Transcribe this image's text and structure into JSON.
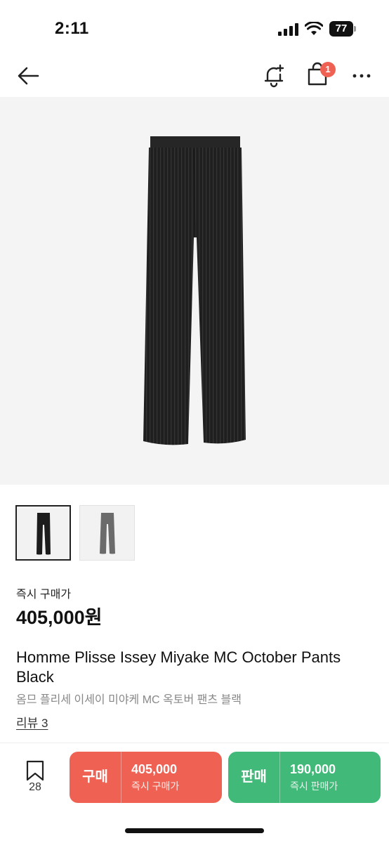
{
  "status_bar": {
    "time": "2:11",
    "battery": "77"
  },
  "nav": {
    "back_icon": "arrow-left-icon",
    "alert_icon": "bell-plus-icon",
    "cart_icon": "shopping-bag-icon",
    "cart_badge": "1",
    "more_icon": "more-horizontal-icon"
  },
  "product": {
    "price_label": "즉시 구매가",
    "price": "405,000원",
    "title": "Homme Plisse Issey Miyake MC October Pants Black",
    "subtitle": "옴므 플리세 이세이 미야케 MC 옥토버 팬츠 블랙",
    "reviews": "리뷰 3"
  },
  "thumbnails": [
    {
      "color": "black",
      "selected": true
    },
    {
      "color": "gray",
      "selected": false
    }
  ],
  "bottom_bar": {
    "bookmark_icon": "bookmark-icon",
    "bookmark_count": "28",
    "buy": {
      "label": "구매",
      "price": "405,000",
      "sub": "즉시 구매가"
    },
    "sell": {
      "label": "판매",
      "price": "190,000",
      "sub": "즉시 판매가"
    }
  },
  "colors": {
    "buy": "#ef6253",
    "sell": "#41b979",
    "badge": "#ef6253"
  }
}
